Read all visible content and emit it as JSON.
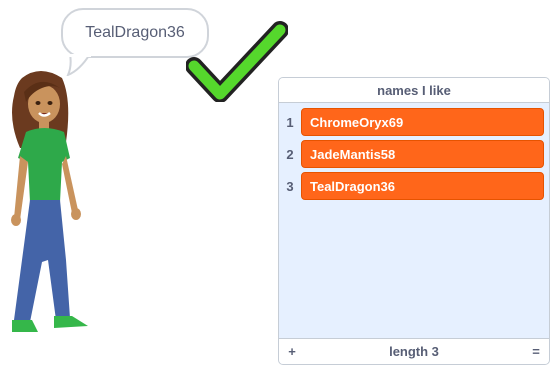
{
  "bubble": {
    "text": "TealDragon36"
  },
  "list_monitor": {
    "title": "names I like",
    "items": [
      {
        "index": "1",
        "value": "ChromeOryx69"
      },
      {
        "index": "2",
        "value": "JadeMantis58"
      },
      {
        "index": "3",
        "value": "TealDragon36"
      }
    ],
    "footer": {
      "add_label": "+",
      "length_label": "length 3",
      "resize_label": "="
    }
  },
  "colors": {
    "item_fill": "#ff661a",
    "list_bg": "#e6f0ff",
    "check_green": "#55d82c"
  },
  "icons": {
    "checkmark": "checkmark-icon"
  }
}
